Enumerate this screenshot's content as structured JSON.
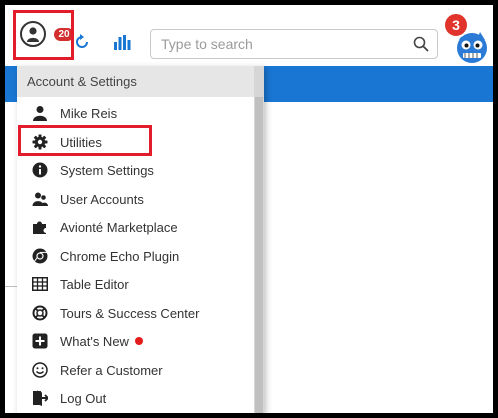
{
  "header": {
    "user_badge_count": "20",
    "notification_count": "3",
    "search": {
      "placeholder": "Type to search"
    }
  },
  "menu": {
    "header": "Account & Settings",
    "items": [
      {
        "label": "Mike Reis",
        "icon": "user-icon"
      },
      {
        "label": "Utilities",
        "icon": "gear-icon"
      },
      {
        "label": "System Settings",
        "icon": "info-icon"
      },
      {
        "label": "User Accounts",
        "icon": "users-icon"
      },
      {
        "label": "Avionté Marketplace",
        "icon": "puzzle-icon"
      },
      {
        "label": "Chrome Echo Plugin",
        "icon": "chrome-icon"
      },
      {
        "label": "Table Editor",
        "icon": "table-icon"
      },
      {
        "label": "Tours & Success Center",
        "icon": "lifebuoy-icon"
      },
      {
        "label": "What's New",
        "icon": "plus-square-icon"
      },
      {
        "label": "Refer a Customer",
        "icon": "smile-icon"
      },
      {
        "label": "Log Out",
        "icon": "logout-icon"
      }
    ]
  },
  "colors": {
    "header_blue": "#1976d2",
    "highlight_red": "#e31c2c",
    "badge_red": "#d32f2f",
    "menu_header_bg": "#e6e6e6"
  }
}
